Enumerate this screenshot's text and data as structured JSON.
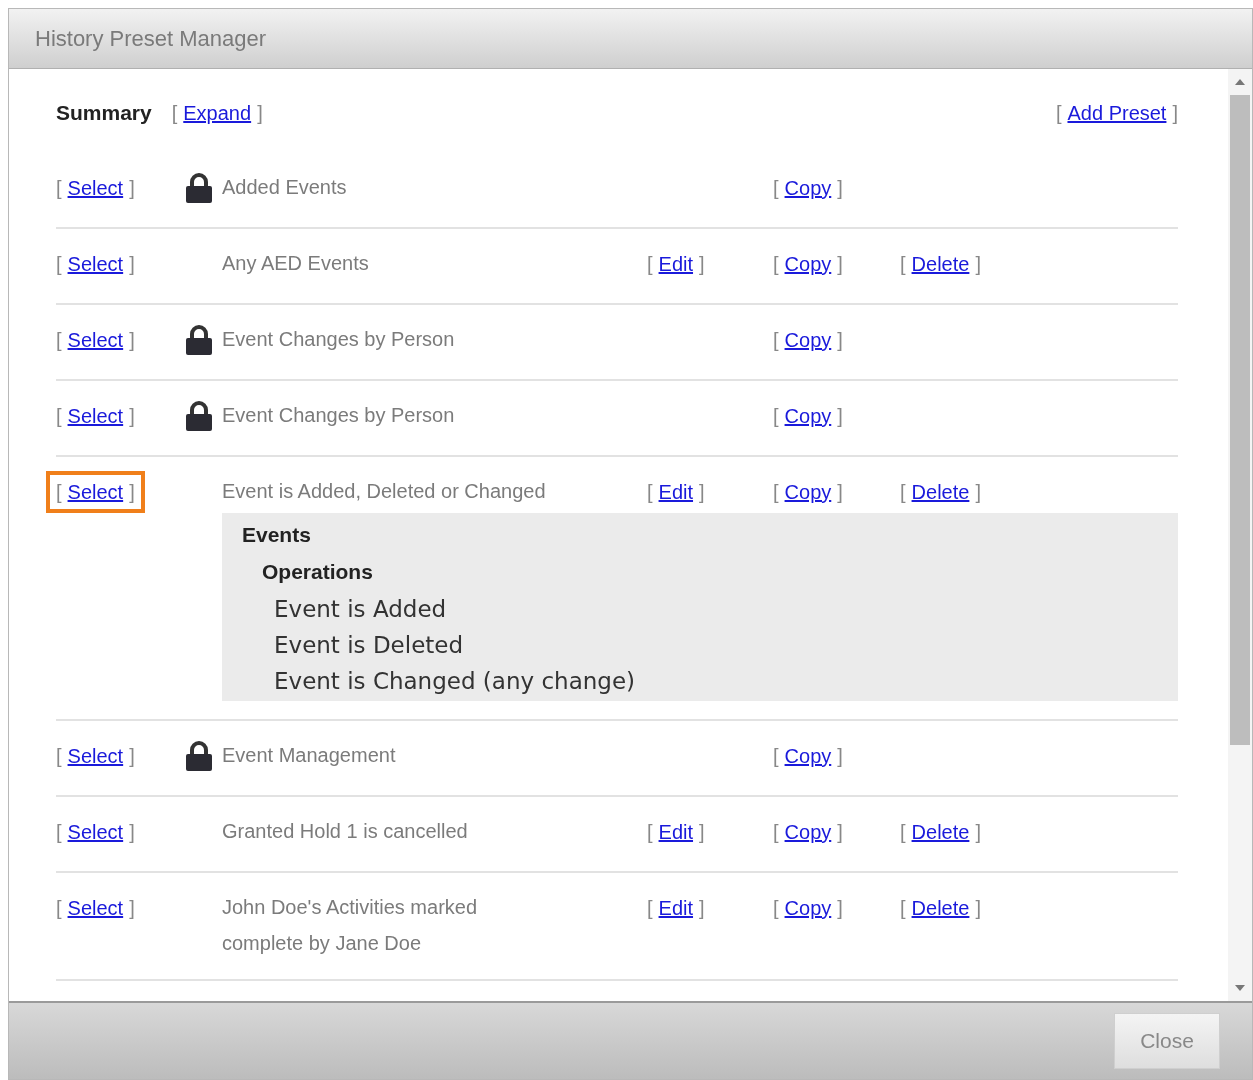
{
  "window": {
    "title": "History Preset Manager"
  },
  "summary": {
    "label": "Summary",
    "expand": {
      "before": "[",
      "label": "Expand",
      "after": "]"
    },
    "add_preset": {
      "before": "[",
      "label": "Add Preset",
      "after": "]"
    }
  },
  "presets": [
    {
      "select": {
        "before": "[",
        "label": "Select",
        "after": "]",
        "selected": false
      },
      "locked": true,
      "name": "Added Events",
      "copy": {
        "before": "[",
        "label": "Copy",
        "after": "]"
      }
    },
    {
      "select": {
        "before": "[",
        "label": "Select",
        "after": "]",
        "selected": false
      },
      "locked": false,
      "name": "Any AED Events",
      "edit": {
        "before": "[",
        "label": "Edit",
        "after": "]"
      },
      "copy": {
        "before": "[",
        "label": "Copy",
        "after": "]"
      },
      "delete": {
        "before": "[",
        "label": "Delete",
        "after": "]"
      }
    },
    {
      "select": {
        "before": "[",
        "label": "Select",
        "after": "]",
        "selected": false
      },
      "locked": true,
      "name": "Event Changes by Person",
      "copy": {
        "before": "[",
        "label": "Copy",
        "after": "]"
      }
    },
    {
      "select": {
        "before": "[",
        "label": "Select",
        "after": "]",
        "selected": false
      },
      "locked": true,
      "name": "Event Changes by Person",
      "copy": {
        "before": "[",
        "label": "Copy",
        "after": "]"
      }
    },
    {
      "select": {
        "before": "[",
        "label": "Select",
        "after": "]",
        "selected": true
      },
      "locked": false,
      "name": "Event is Added, Deleted or Changed",
      "edit": {
        "before": "[",
        "label": "Edit",
        "after": "]"
      },
      "copy": {
        "before": "[",
        "label": "Copy",
        "after": "]"
      },
      "delete": {
        "before": "[",
        "label": "Delete",
        "after": "]"
      },
      "details": [
        {
          "heading": "Events",
          "children": [
            {
              "heading": "Operations",
              "items": [
                "Event is Added",
                "Event is Deleted",
                "Event is Changed (any change)"
              ]
            }
          ]
        }
      ]
    },
    {
      "select": {
        "before": "[",
        "label": "Select",
        "after": "]",
        "selected": false
      },
      "locked": true,
      "name": "Event Management",
      "copy": {
        "before": "[",
        "label": "Copy",
        "after": "]"
      }
    },
    {
      "select": {
        "before": "[",
        "label": "Select",
        "after": "]",
        "selected": false
      },
      "locked": false,
      "name": "Granted Hold 1 is cancelled",
      "edit": {
        "before": "[",
        "label": "Edit",
        "after": "]"
      },
      "copy": {
        "before": "[",
        "label": "Copy",
        "after": "]"
      },
      "delete": {
        "before": "[",
        "label": "Delete",
        "after": "]"
      }
    },
    {
      "select": {
        "before": "[",
        "label": "Select",
        "after": "]",
        "selected": false
      },
      "locked": false,
      "name": "John Doe's Activities marked complete by Jane Doe",
      "edit": {
        "before": "[",
        "label": "Edit",
        "after": "]"
      },
      "copy": {
        "before": "[",
        "label": "Copy",
        "after": "]"
      },
      "delete": {
        "before": "[",
        "label": "Delete",
        "after": "]"
      }
    }
  ],
  "footer": {
    "close": "Close"
  }
}
